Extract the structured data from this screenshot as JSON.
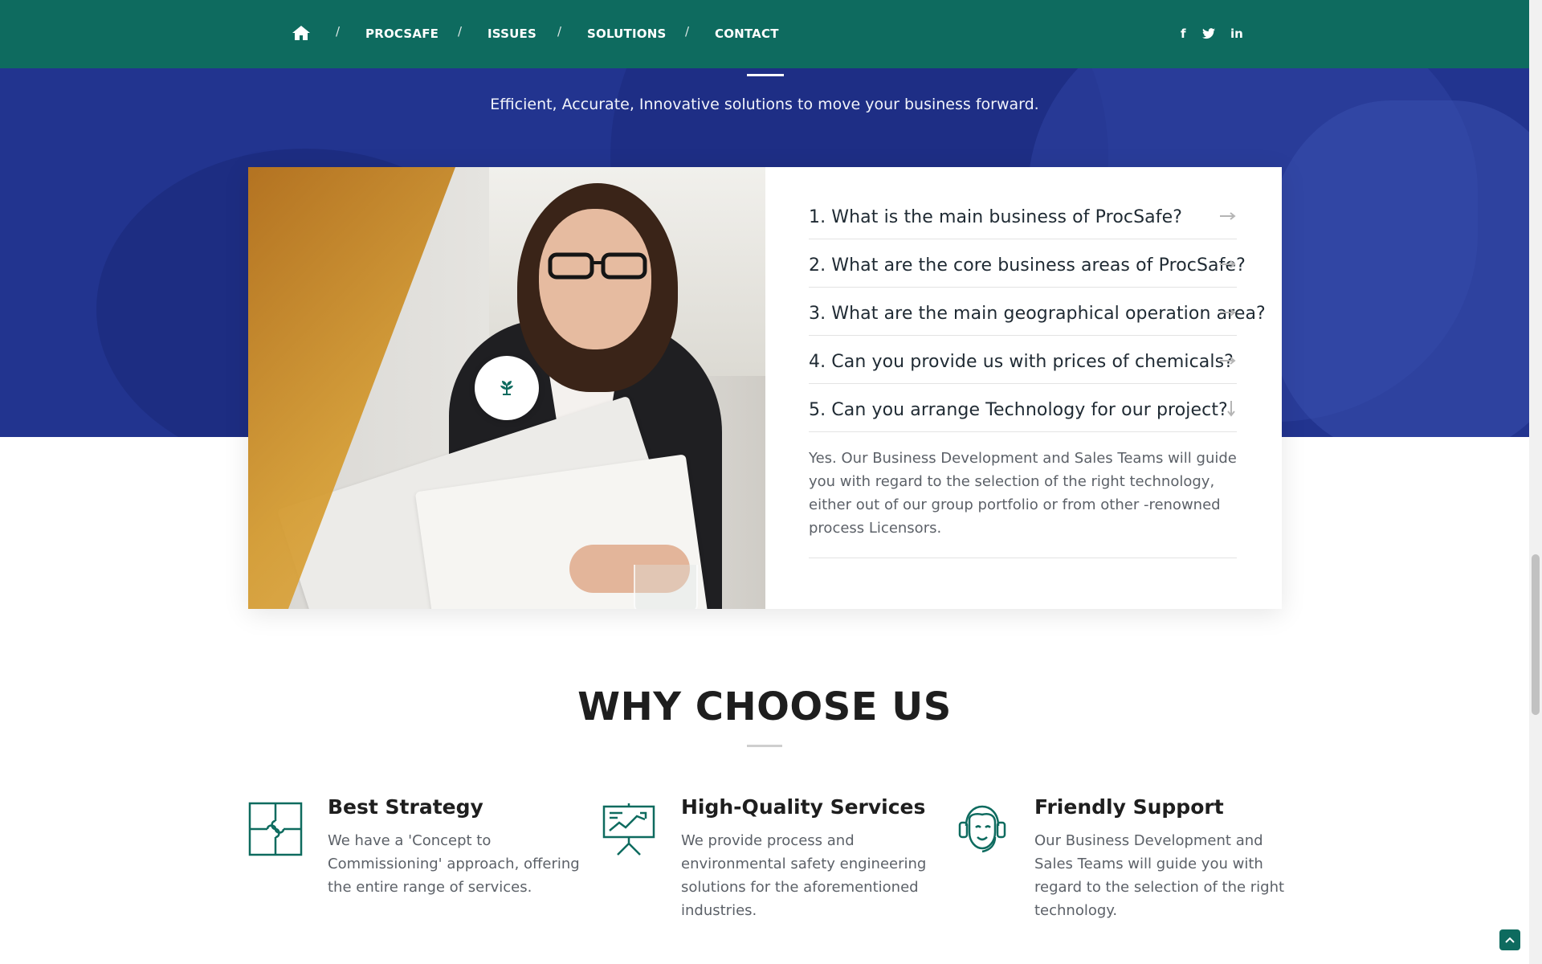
{
  "nav": {
    "home_icon": "home-icon",
    "separator": "/",
    "links": [
      "PROCSAFE",
      "ISSUES",
      "SOLUTIONS",
      "CONTACT"
    ],
    "social": [
      "f",
      "twitter-icon",
      "in"
    ]
  },
  "hero": {
    "tagline": "Efficient, Accurate, Innovative solutions to move your business forward."
  },
  "faq": {
    "items": [
      "1. What is the main business of ProcSafe?",
      "2. What are the core business areas of ProcSafe?",
      "3. What are the main geographical operation area?",
      "4. Can you provide us with prices of chemicals?",
      "5. Can you arrange Technology for our project?"
    ],
    "open_index": 4,
    "answer": "Yes. Our Business Development and Sales Teams will guide you with regard to the selection of the right technology, either out of our group portfolio or from other -renowned process Licensors."
  },
  "why": {
    "title": "WHY CHOOSE US",
    "features": [
      {
        "icon": "puzzle-icon",
        "title": "Best Strategy",
        "text": "We have a 'Concept to Commissioning' approach, offering the entire range of services."
      },
      {
        "icon": "presentation-chart-icon",
        "title": "High-Quality Services",
        "text": "We provide process and environmental safety engineering solutions for the aforementioned industries."
      },
      {
        "icon": "support-headset-icon",
        "title": "Friendly Support",
        "text": "Our Business Development and Sales Teams will guide you with regard to the selection of the right technology."
      }
    ]
  },
  "colors": {
    "nav_green": "#0e6b5f",
    "hero_blue": "#22348f",
    "icon_teal": "#0e6b5f"
  }
}
